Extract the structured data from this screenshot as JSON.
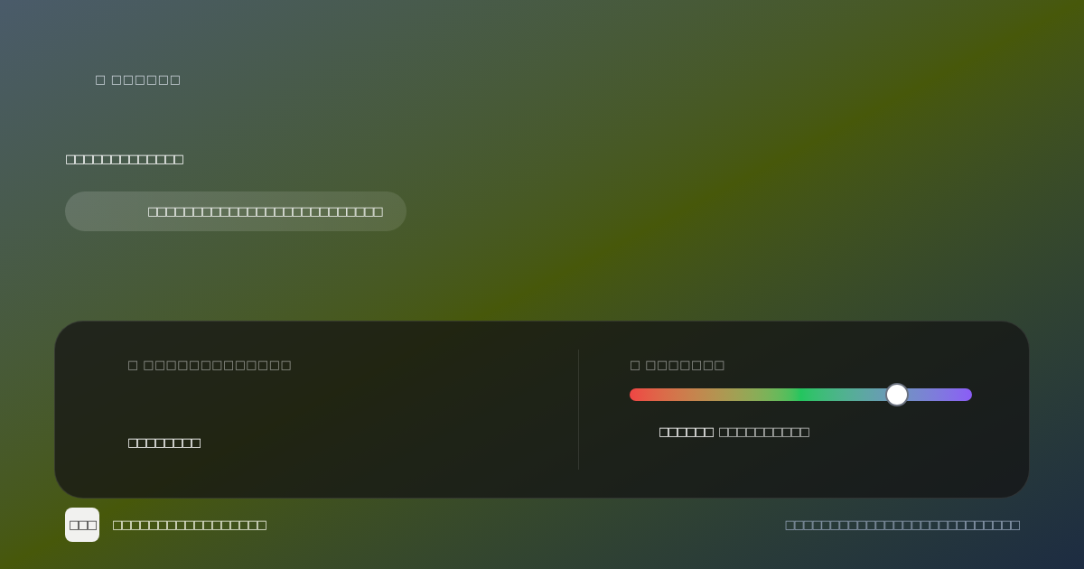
{
  "header": {
    "title": "□ □□□□□□"
  },
  "intro": {
    "label": "□□□□□□□□□□□□□",
    "pill": "□□□□□□□□□□□□□□□□□□□□□□□□□□"
  },
  "panel": {
    "left": {
      "label": "□ □□□□□□□□□□□□□",
      "value": "□□□□□□□□"
    },
    "right": {
      "label": "□ □□□□□□□",
      "slider": {
        "level": 0.78
      },
      "value": "□□□□□□",
      "caption": "□□□□□□□□□□"
    }
  },
  "footer": {
    "logo": "□□□",
    "brand": "□□□□□□□□□□□□□□□□□",
    "note": "□□□□□□□□□□□□□□□□□□□□□□□□□□"
  }
}
